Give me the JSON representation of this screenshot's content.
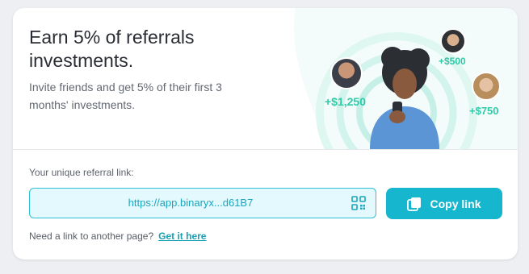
{
  "header": {
    "title_line1": "Earn 5% of referrals",
    "title_line2": "investments.",
    "subtitle_line1": "Invite friends and get 5% of their first 3",
    "subtitle_line2": "months' investments."
  },
  "illustration": {
    "amounts": [
      "+$1,250",
      "+$500",
      "+$750"
    ]
  },
  "referral": {
    "label": "Your unique referral link:",
    "link": "https://app.binaryx...d61B7",
    "copy_label": "Copy link",
    "another_prompt": "Need a link to another page?",
    "get_link_label": "Get it here"
  },
  "colors": {
    "accent": "#16b6ce",
    "amount_green": "#2fcaa8",
    "input_bg": "#e3f9fd"
  },
  "icons": {
    "qr": "qr-code-icon",
    "copy": "copy-icon"
  }
}
